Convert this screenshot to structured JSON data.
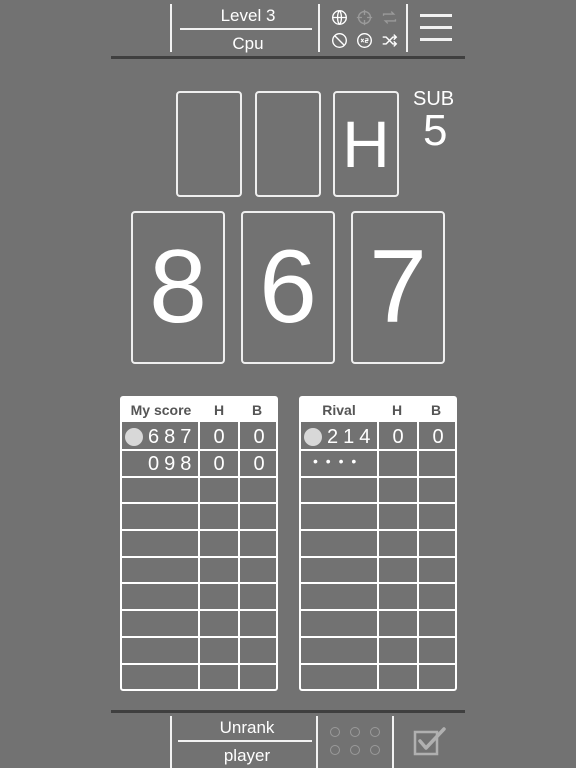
{
  "header": {
    "level": "Level 3",
    "opponent": "Cpu",
    "icons": [
      "globe-icon",
      "crosshair-icon",
      "repeat-icon",
      "half-circle-icon",
      "x2-icon",
      "shuffle-icon"
    ]
  },
  "board": {
    "clue_slots": [
      "",
      "",
      "H"
    ],
    "sub_label": "SUB",
    "sub_value": "5",
    "number_cards": [
      "8",
      "6",
      "7"
    ]
  },
  "my_table": {
    "headers": [
      "My score",
      "H",
      "B"
    ],
    "rows": [
      {
        "guess": "687",
        "h": "0",
        "b": "0"
      },
      {
        "guess": "098",
        "h": "0",
        "b": "0"
      }
    ]
  },
  "rival_table": {
    "headers": [
      "Rival",
      "H",
      "B"
    ],
    "rows": [
      {
        "guess": "214",
        "h": "0",
        "b": "0"
      },
      {
        "guess": "• • • •",
        "h": "",
        "b": ""
      }
    ]
  },
  "footer": {
    "rank": "Unrank",
    "role": "player",
    "confirm_icon": "checkbox-icon"
  }
}
